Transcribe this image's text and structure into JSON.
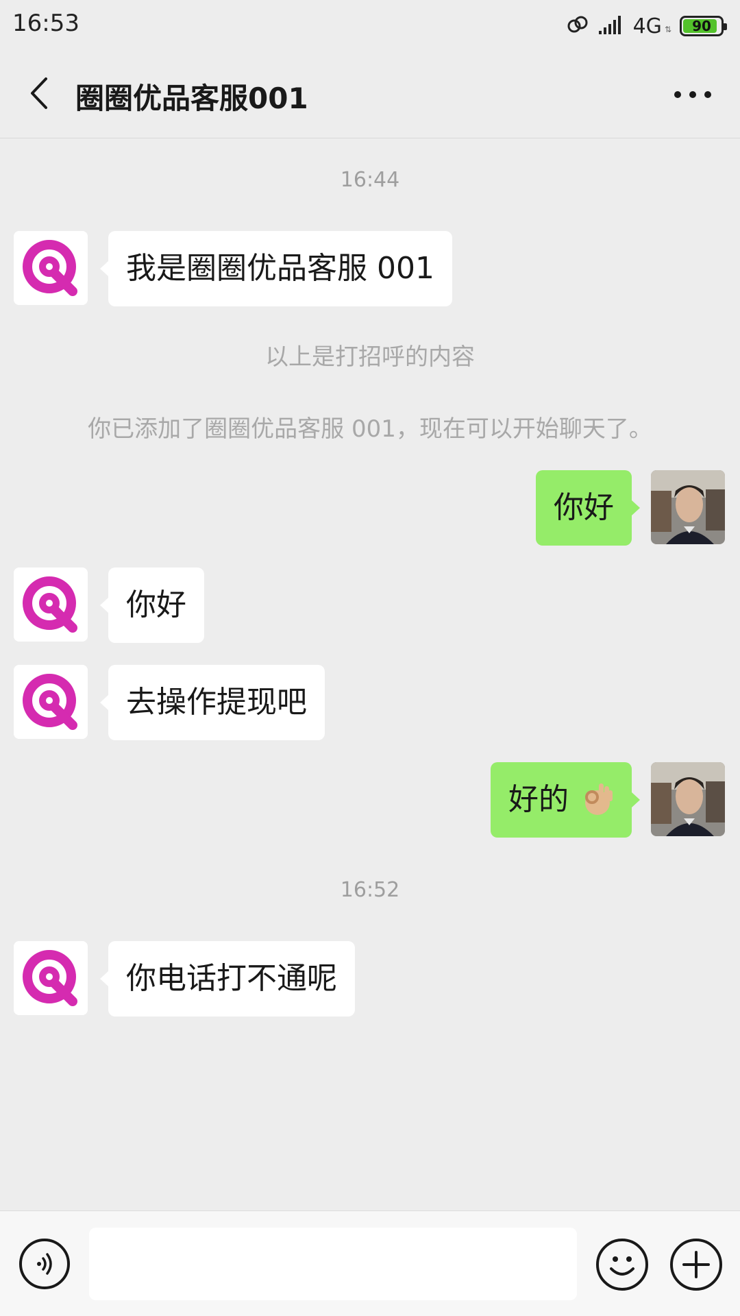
{
  "status_bar": {
    "time": "16:53",
    "network": "4G",
    "battery": "90",
    "battery_level_percent": 90
  },
  "header": {
    "title": "圈圈优品客服001",
    "back_icon": "chevron-left-icon",
    "more_icon": "more-dots-icon"
  },
  "messages": {
    "time1": "16:44",
    "msg1": "我是圈圈优品客服 001",
    "sys1": "以上是打招呼的内容",
    "sys2": "你已添加了圈圈优品客服 001，现在可以开始聊天了。",
    "msg2": "你好",
    "msg3": "你好",
    "msg4": "去操作提现吧",
    "msg5": "好的",
    "msg5_emoji": "ok-hand-emoji",
    "time2": "16:52",
    "msg6": "你电话打不通呢"
  },
  "input_bar": {
    "voice_icon": "voice-icon",
    "text_value": "",
    "emoji_icon": "emoji-icon",
    "plus_icon": "plus-icon"
  },
  "colors": {
    "background": "#ededed",
    "sent_bubble": "#95ec69",
    "received_bubble": "#ffffff",
    "brand_magenta": "#d52bb0"
  }
}
